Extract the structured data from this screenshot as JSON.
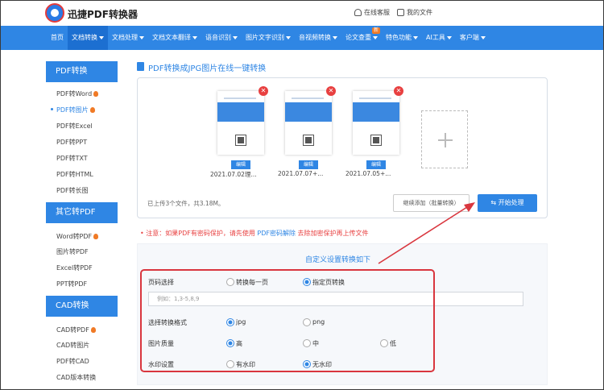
{
  "header": {
    "brand": "迅捷PDF转换器",
    "service": "在线客服",
    "my_files": "我的文件"
  },
  "nav": {
    "items": [
      "首页",
      "文档转换",
      "文档处理",
      "文档文本翻译",
      "语音识别",
      "图片文字识别",
      "音视频转换",
      "论文查重",
      "特色功能",
      "AI工具",
      "客户端"
    ],
    "new_badge": "新"
  },
  "sidebar": {
    "sections": [
      {
        "title": "PDF转换",
        "items": [
          "PDF转Word",
          "PDF转图片",
          "PDF转Excel",
          "PDF转PPT",
          "PDF转TXT",
          "PDF转HTML",
          "PDF转长图"
        ]
      },
      {
        "title": "其它转PDF",
        "items": [
          "Word转PDF",
          "图片转PDF",
          "Excel转PDF",
          "PPT转PDF"
        ]
      },
      {
        "title": "CAD转换",
        "items": [
          "CAD转PDF",
          "CAD转图片",
          "PDF转CAD",
          "CAD版本转换"
        ]
      }
    ]
  },
  "main": {
    "title": "PDF转换成JPG图片在线一键转换",
    "files": [
      {
        "name": "2021.07.02理...",
        "edit": "编辑"
      },
      {
        "name": "2021.07.07+...",
        "edit": "编辑"
      },
      {
        "name": "2021.07.05+...",
        "edit": "编辑"
      }
    ],
    "upload_info": "已上传3个文件，共3.18M。",
    "continue_add": "继续添加（批量转换）",
    "start": "开始处理",
    "note_prefix": "注意：如果PDF有密码保护，请先使用",
    "note_link": "PDF密码解除",
    "note_suffix": "去除加密保护再上传文件"
  },
  "settings": {
    "title": "自定义设置转换如下",
    "page_label": "页码选择",
    "page_opt1": "转换每一页",
    "page_opt2": "指定页转换",
    "page_placeholder": "例如：1,3-5,8,9",
    "format_label": "选择转换格式",
    "format_jpg": "jpg",
    "format_png": "png",
    "quality_label": "图片质量",
    "quality_high": "高",
    "quality_mid": "中",
    "quality_low": "低",
    "watermark_label": "水印设置",
    "wm_yes": "有水印",
    "wm_no": "无水印"
  },
  "colors": {
    "brand_blue": "#2f86e4",
    "alert_red": "#e84040",
    "highlight": "#d9363e",
    "fire": "#f07a26"
  }
}
